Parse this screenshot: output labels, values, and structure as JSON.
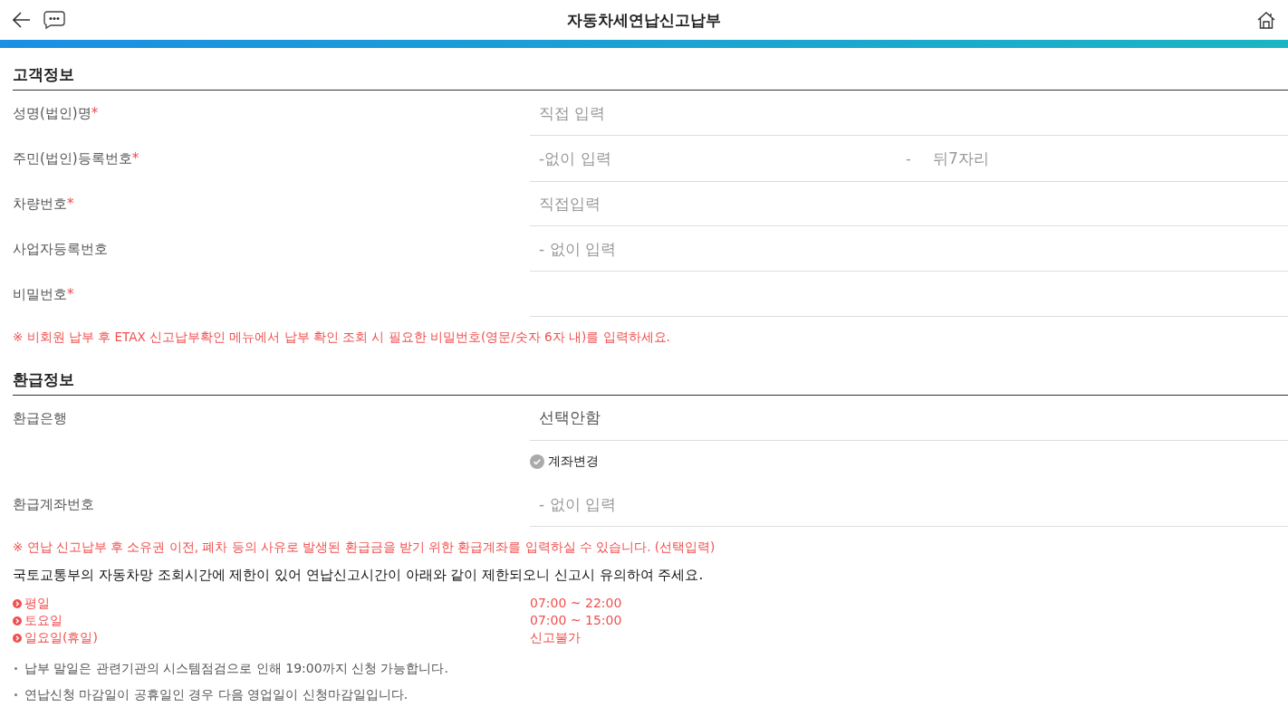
{
  "header": {
    "title": "자동차세연납신고납부"
  },
  "customer_section": {
    "title": "고객정보",
    "fields": [
      {
        "kind": "text",
        "label": "성명(법인)명",
        "required_mark": "*",
        "placeholder": "직접 입력"
      },
      {
        "kind": "split",
        "label": "주민(법인)등록번호",
        "required_mark": "*",
        "placeholder": "-없이 입력",
        "separator": "-",
        "placeholder_2": "뒤7자리"
      },
      {
        "kind": "text",
        "label": "차량번호",
        "required_mark": "*",
        "placeholder": "직접입력"
      },
      {
        "kind": "text",
        "label": "사업자등록번호",
        "placeholder": "- 없이 입력"
      },
      {
        "kind": "password",
        "label": "비밀번호",
        "required_mark": "*"
      }
    ],
    "note": "※ 비회원 납부 후 ETAX 신고납부확인 메뉴에서 납부 확인 조회 시 필요한 비밀번호(영문/숫자 6자 내)를 입력하세요."
  },
  "refund_section": {
    "title": "환급정보",
    "fields": [
      {
        "kind": "select",
        "label": "환급은행",
        "value": "선택안함"
      },
      {
        "kind": "checkbox",
        "text": "계좌변경",
        "checked": false
      },
      {
        "kind": "text",
        "label": "환급계좌번호",
        "placeholder": "- 없이 입력"
      }
    ],
    "note": "※ 연납 신고납부 후 소유권 이전, 폐차 등의 사유로 발생된 환급금을 받기 위한 환급계좌를 입력하실 수 있습니다. (선택입력)"
  },
  "notice": "국토교통부의 자동차망 조회시간에 제한이 있어 연납신고시간이 아래와 같이 제한되오니 신고시 유의하여 주세요.",
  "schedule": [
    {
      "day": "평일",
      "time": "07:00 ~ 22:00"
    },
    {
      "day": "토요일",
      "time": "07:00 ~ 15:00"
    },
    {
      "day": "일요일(휴일)",
      "time": "신고불가"
    }
  ],
  "notes": [
    "납부 말일은 관련기관의 시스템점검으로 인해 19:00까지 신청 가능합니다.",
    "연납신청 마감일이 공휴일인 경우 다음 영업일이 신청마감일입니다."
  ]
}
